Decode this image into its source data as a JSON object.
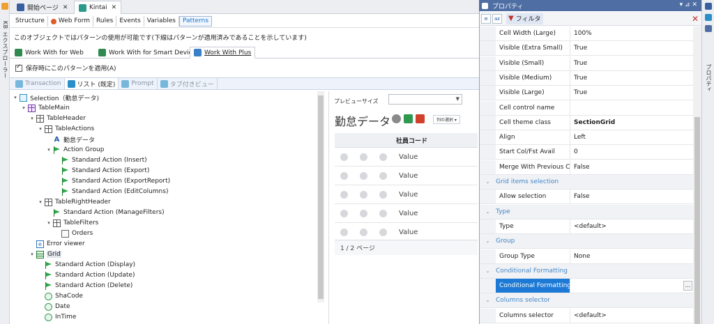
{
  "kb_explorer": {
    "label": "KB エクスプローラー"
  },
  "doc_tabs": [
    {
      "label": "開始ページ",
      "icon": "gx-icon"
    },
    {
      "label": "Kintai",
      "icon": "transaction-icon"
    }
  ],
  "object_tabs": [
    "Structure",
    "Web Form",
    "Rules",
    "Events",
    "Variables",
    "Patterns"
  ],
  "active_object_tab": "Patterns",
  "info_text": "このオブジェクトではパターンの使用が可能です(下線はパターンが適用済みであることを示しています)",
  "pattern_tabs": [
    "Work With for Web",
    "Work With for Smart Devices",
    "Work With Plus"
  ],
  "active_pattern_tab": "Work With Plus",
  "apply_on_save": {
    "label": "保存時にこのパターンを適用(A)",
    "checked": true
  },
  "sub_tabs": [
    "Transaction",
    "リスト (既定)",
    "Prompt",
    "タブ付きビュー"
  ],
  "active_sub_tab": "リスト (既定)",
  "tree": [
    {
      "label": "Selection（勤怠データ)",
      "icon": "selection-icon",
      "depth": 0,
      "toggle": "▾"
    },
    {
      "label": "TableMain",
      "icon": "table-main-icon",
      "depth": 1,
      "toggle": "▾"
    },
    {
      "label": "TableHeader",
      "icon": "table-icon",
      "depth": 2,
      "toggle": "▾"
    },
    {
      "label": "TableActions",
      "icon": "table-icon",
      "depth": 3,
      "toggle": "▾"
    },
    {
      "label": "勤怠データ",
      "icon": "text-icon",
      "depth": 4,
      "toggle": ""
    },
    {
      "label": "Action Group",
      "icon": "flag-icon",
      "depth": 4,
      "toggle": "▾"
    },
    {
      "label": "Standard Action (Insert)",
      "icon": "flag-icon",
      "depth": 5,
      "toggle": ""
    },
    {
      "label": "Standard Action (Export)",
      "icon": "flag-icon",
      "depth": 5,
      "toggle": ""
    },
    {
      "label": "Standard Action (ExportReport)",
      "icon": "flag-icon",
      "depth": 5,
      "toggle": ""
    },
    {
      "label": "Standard Action (EditColumns)",
      "icon": "flag-icon",
      "depth": 5,
      "toggle": ""
    },
    {
      "label": "TableRightHeader",
      "icon": "table-icon",
      "depth": 3,
      "toggle": "▾"
    },
    {
      "label": "Standard Action (ManageFilters)",
      "icon": "flag-icon",
      "depth": 4,
      "toggle": ""
    },
    {
      "label": "TableFilters",
      "icon": "table-icon",
      "depth": 4,
      "toggle": "▾"
    },
    {
      "label": "Orders",
      "icon": "orders-icon",
      "depth": 5,
      "toggle": ""
    },
    {
      "label": "Error viewer",
      "icon": "error-viewer-icon",
      "depth": 2,
      "toggle": ""
    },
    {
      "label": "Grid",
      "icon": "grid-icon",
      "depth": 2,
      "toggle": "▾",
      "highlighted": true
    },
    {
      "label": "Standard Action (Display)",
      "icon": "flag-icon",
      "depth": 3,
      "toggle": ""
    },
    {
      "label": "Standard Action (Update)",
      "icon": "flag-icon",
      "depth": 3,
      "toggle": ""
    },
    {
      "label": "Standard Action (Delete)",
      "icon": "flag-icon",
      "depth": 3,
      "toggle": ""
    },
    {
      "label": "ShaCode",
      "icon": "attribute-icon",
      "depth": 3,
      "toggle": ""
    },
    {
      "label": "Date",
      "icon": "attribute-icon",
      "depth": 3,
      "toggle": ""
    },
    {
      "label": "InTime",
      "icon": "attribute-icon",
      "depth": 3,
      "toggle": ""
    }
  ],
  "preview": {
    "size_label": "プレビューサイズ",
    "size_value": "",
    "title": "勤怠データ",
    "column_select": "列の選択 ▾",
    "column_header": "社員コード",
    "rows": [
      "Value",
      "Value",
      "Value",
      "Value",
      "Value"
    ],
    "pager": "1 / 2 ページ"
  },
  "properties": {
    "title": "プロパティ",
    "filter_label": "フィルタ",
    "rows": [
      {
        "type": "prop",
        "key": "Cell Width (Large)",
        "value": "100%"
      },
      {
        "type": "prop",
        "key": "Visible (Extra Small)",
        "value": "True"
      },
      {
        "type": "prop",
        "key": "Visible (Small)",
        "value": "True"
      },
      {
        "type": "prop",
        "key": "Visible (Medium)",
        "value": "True"
      },
      {
        "type": "prop",
        "key": "Visible (Large)",
        "value": "True"
      },
      {
        "type": "prop",
        "key": "Cell control name",
        "value": ""
      },
      {
        "type": "prop",
        "key": "Cell theme class",
        "value": "SectionGrid",
        "bold": true
      },
      {
        "type": "prop",
        "key": "Align",
        "value": "Left"
      },
      {
        "type": "prop",
        "key": "Start Col/Fst Avail",
        "value": "0"
      },
      {
        "type": "prop",
        "key": "Merge With Previous Ce",
        "value": "False"
      },
      {
        "type": "cat",
        "key": "Grid items selection"
      },
      {
        "type": "prop",
        "key": "Allow selection",
        "value": "False"
      },
      {
        "type": "cat",
        "key": "Type"
      },
      {
        "type": "prop",
        "key": "Type",
        "value": "<default>"
      },
      {
        "type": "cat",
        "key": "Group"
      },
      {
        "type": "prop",
        "key": "Group Type",
        "value": "None"
      },
      {
        "type": "cat",
        "key": "Conditional Formatting"
      },
      {
        "type": "prop",
        "key": "Conditional Formatting",
        "value": "",
        "selected": true,
        "ellipsis": "..."
      },
      {
        "type": "cat",
        "key": "Columns selector"
      },
      {
        "type": "prop",
        "key": "Columns selector",
        "value": "<default>"
      }
    ]
  },
  "right_strip": {
    "label": "プロパティ"
  },
  "colors": {
    "accent": "#1c7ad6",
    "header": "#4f6fa4",
    "category_text": "#3f86c9",
    "flag_green": "#2fa84a"
  }
}
